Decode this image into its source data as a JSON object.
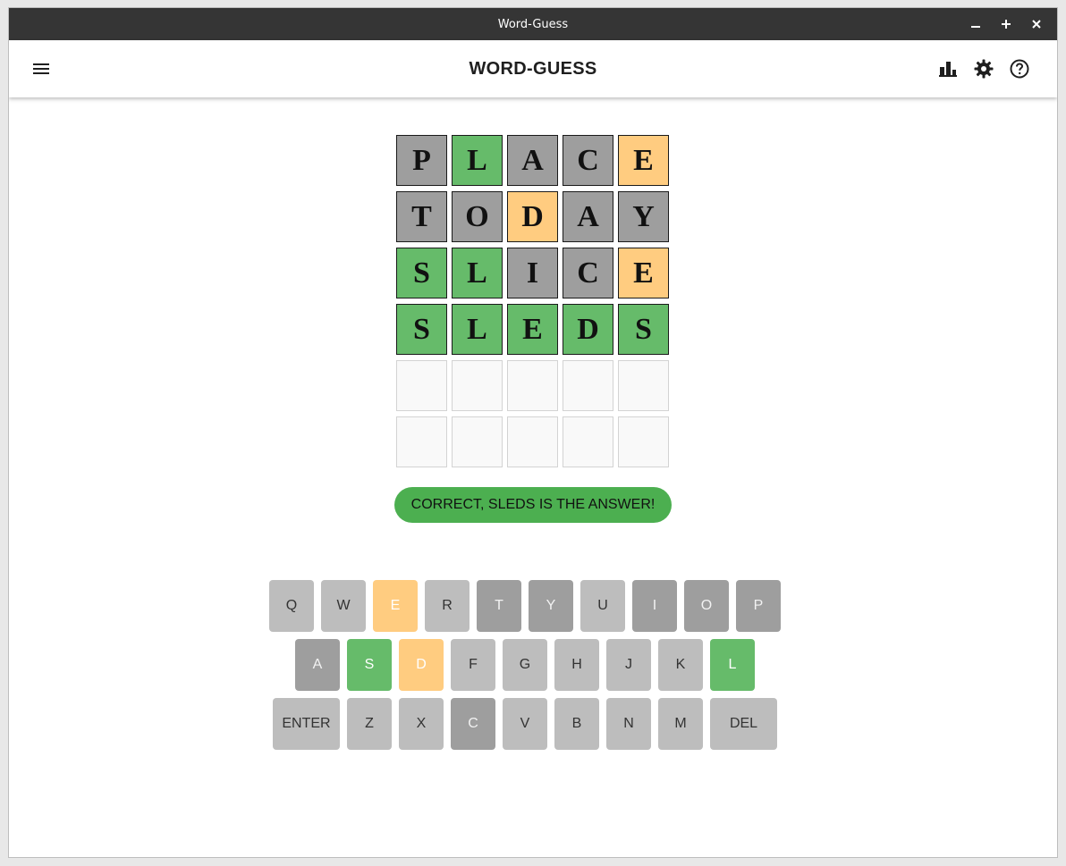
{
  "window": {
    "title": "Word-Guess"
  },
  "header": {
    "title": "WORD-GUESS"
  },
  "colors": {
    "correct": "#66bb6a",
    "present": "#ffcc80",
    "absent": "#9e9e9e",
    "unused": "#bdbdbd",
    "banner": "#4caf50"
  },
  "board": [
    [
      [
        "P",
        "gray"
      ],
      [
        "L",
        "green"
      ],
      [
        "A",
        "gray"
      ],
      [
        "C",
        "gray"
      ],
      [
        "E",
        "orange"
      ]
    ],
    [
      [
        "T",
        "gray"
      ],
      [
        "O",
        "gray"
      ],
      [
        "D",
        "orange"
      ],
      [
        "A",
        "gray"
      ],
      [
        "Y",
        "gray"
      ]
    ],
    [
      [
        "S",
        "green"
      ],
      [
        "L",
        "green"
      ],
      [
        "I",
        "gray"
      ],
      [
        "C",
        "gray"
      ],
      [
        "E",
        "orange"
      ]
    ],
    [
      [
        "S",
        "green"
      ],
      [
        "L",
        "green"
      ],
      [
        "E",
        "green"
      ],
      [
        "D",
        "green"
      ],
      [
        "S",
        "green"
      ]
    ],
    [
      [
        "",
        "empty"
      ],
      [
        "",
        "empty"
      ],
      [
        "",
        "empty"
      ],
      [
        "",
        "empty"
      ],
      [
        "",
        "empty"
      ]
    ],
    [
      [
        "",
        "empty"
      ],
      [
        "",
        "empty"
      ],
      [
        "",
        "empty"
      ],
      [
        "",
        "empty"
      ],
      [
        "",
        "empty"
      ]
    ]
  ],
  "message": "CORRECT, SLEDS IS THE ANSWER!",
  "keyboard": [
    [
      [
        "Q",
        "k-light"
      ],
      [
        "W",
        "k-light"
      ],
      [
        "E",
        "k-orange"
      ],
      [
        "R",
        "k-light"
      ],
      [
        "T",
        "k-dark"
      ],
      [
        "Y",
        "k-dark"
      ],
      [
        "U",
        "k-light"
      ],
      [
        "I",
        "k-dark"
      ],
      [
        "O",
        "k-dark"
      ],
      [
        "P",
        "k-dark"
      ]
    ],
    [
      [
        "A",
        "k-dark"
      ],
      [
        "S",
        "k-green"
      ],
      [
        "D",
        "k-orange"
      ],
      [
        "F",
        "k-light"
      ],
      [
        "G",
        "k-light"
      ],
      [
        "H",
        "k-light"
      ],
      [
        "J",
        "k-light"
      ],
      [
        "K",
        "k-light"
      ],
      [
        "L",
        "k-green"
      ]
    ],
    [
      [
        "ENTER",
        "k-light"
      ],
      [
        "Z",
        "k-light"
      ],
      [
        "X",
        "k-light"
      ],
      [
        "C",
        "k-dark"
      ],
      [
        "V",
        "k-light"
      ],
      [
        "B",
        "k-light"
      ],
      [
        "N",
        "k-light"
      ],
      [
        "M",
        "k-light"
      ],
      [
        "DEL",
        "k-light"
      ]
    ]
  ],
  "icons": {
    "menu": "menu-icon",
    "stats": "bar-chart-icon",
    "settings": "gear-icon",
    "help": "help-circle-icon"
  }
}
